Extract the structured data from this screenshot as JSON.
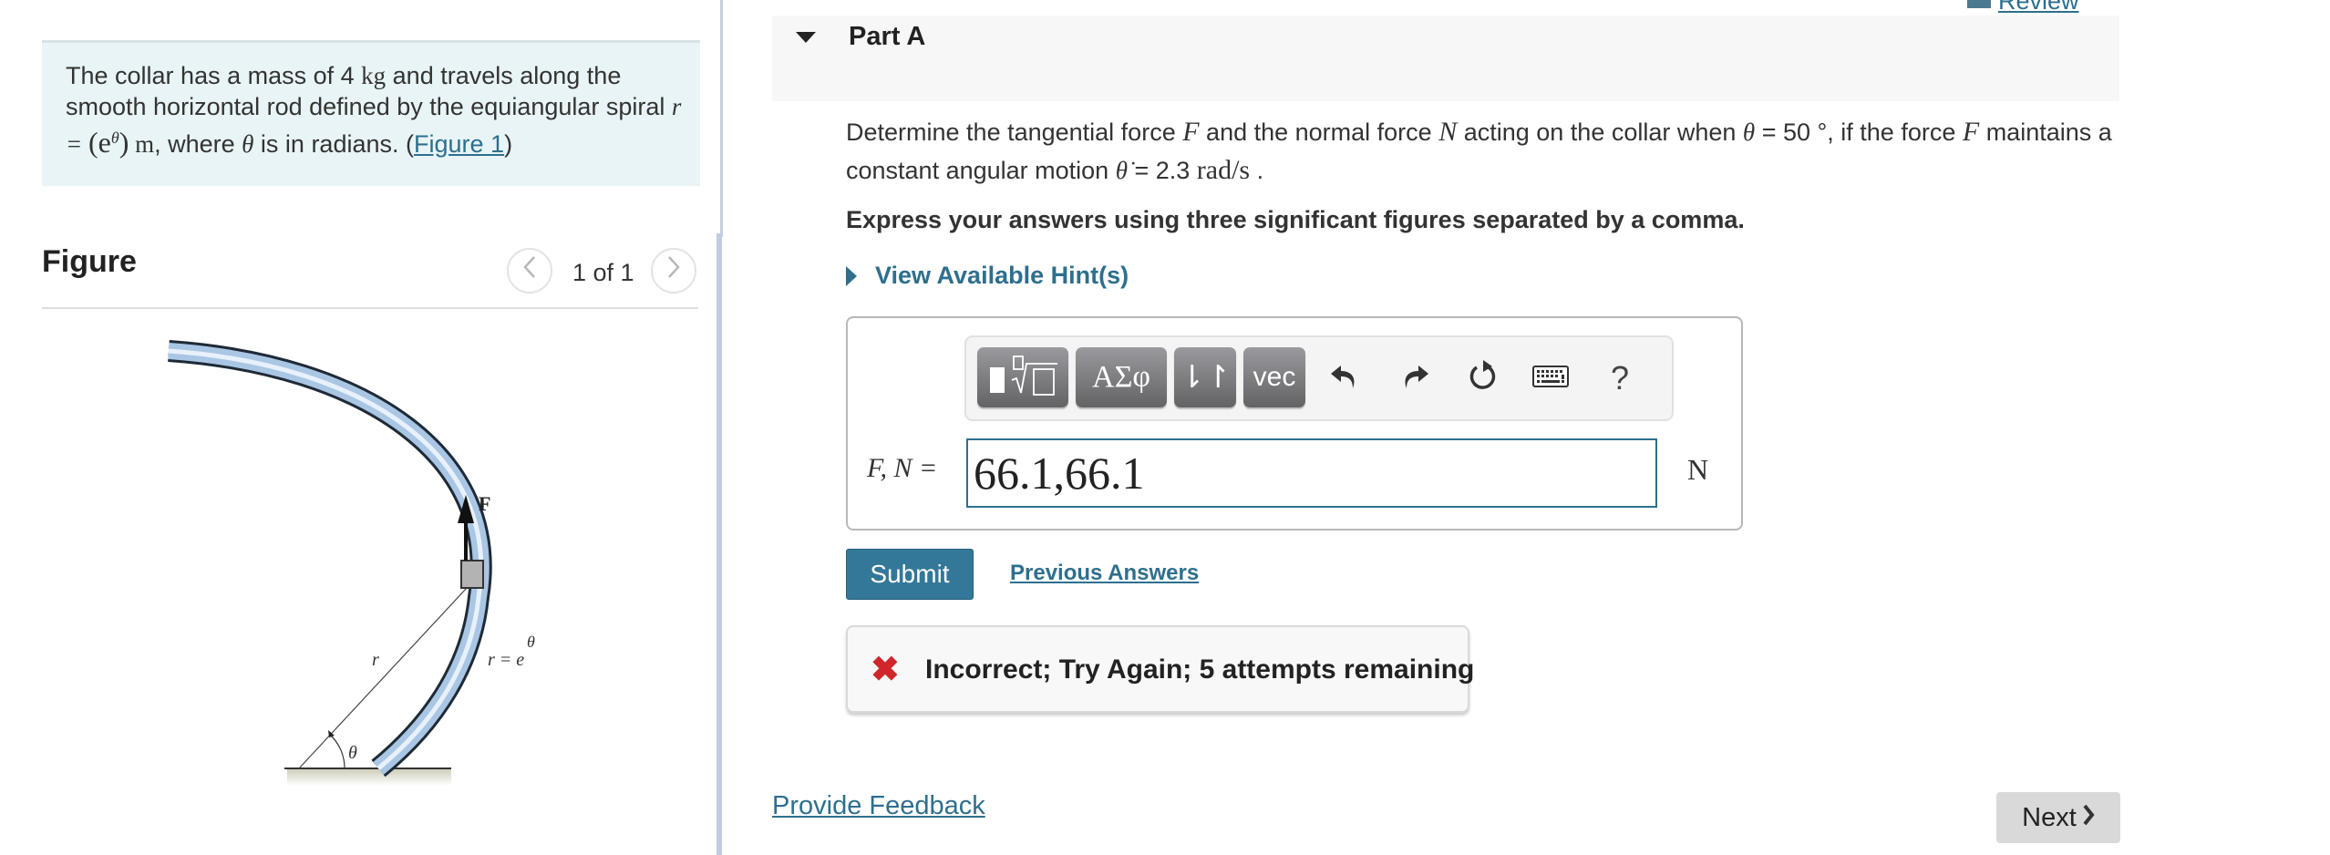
{
  "problem": {
    "text_before_mass": "The collar has a mass of 4 ",
    "mass_unit": "kg",
    "text_after_mass": " and travels along the smooth horizontal rod defined by the equiangular spiral ",
    "equation_lhs": "r = ",
    "equation_rhs": "(e",
    "equation_exp": "θ",
    "equation_close": ")",
    "equation_unit": " m",
    "text_after_eq": ", where ",
    "theta": "θ",
    "text_end": " is in radians. (",
    "figure_link": "Figure 1",
    "close_paren": ")"
  },
  "figure": {
    "title": "Figure",
    "pager_text": "1 of 1",
    "prev_icon": "chevron-left-icon",
    "next_icon": "chevron-right-icon",
    "labels": {
      "force": "F",
      "radius": "r",
      "spiral_eq": "r = e",
      "spiral_exp": "θ",
      "angle": "θ"
    }
  },
  "header": {
    "review_link": "Review"
  },
  "part": {
    "title": "Part A",
    "question_1": "Determine the tangential force ",
    "F": "F",
    "question_2": " and the normal force ",
    "N": "N",
    "question_3": " acting on the collar when ",
    "theta": "θ",
    "question_4": " = 50 °, if the force ",
    "question_5": " maintains a constant angular motion ",
    "theta_dot": "θ̇",
    "question_6": " = 2.3 ",
    "rate_unit": "rad/s",
    "question_7": " .",
    "instruction": "Express your answers using three significant figures separated by a comma.",
    "hint_link": "View Available Hint(s)"
  },
  "toolbar": {
    "templates_label": "templates",
    "greek_label": "ΑΣφ",
    "arrows_label": "⇂↾",
    "vec_label": "vec",
    "undo_icon": "undo-icon",
    "redo_icon": "redo-icon",
    "reset_icon": "reset-icon",
    "keyboard_icon": "keyboard-icon",
    "help_label": "?"
  },
  "answer": {
    "label": "F, N =",
    "value": "66.1,66.1",
    "unit": "N"
  },
  "actions": {
    "submit": "Submit",
    "previous_answers": "Previous Answers"
  },
  "feedback": {
    "icon": "✖",
    "message": "Incorrect; Try Again; 5 attempts remaining"
  },
  "footer": {
    "provide_feedback": "Provide Feedback",
    "next": "Next"
  },
  "colors": {
    "accent": "#2e6f8e",
    "submit_bg": "#337899",
    "error": "#d0262b",
    "info_bg": "#e8f4f6"
  }
}
